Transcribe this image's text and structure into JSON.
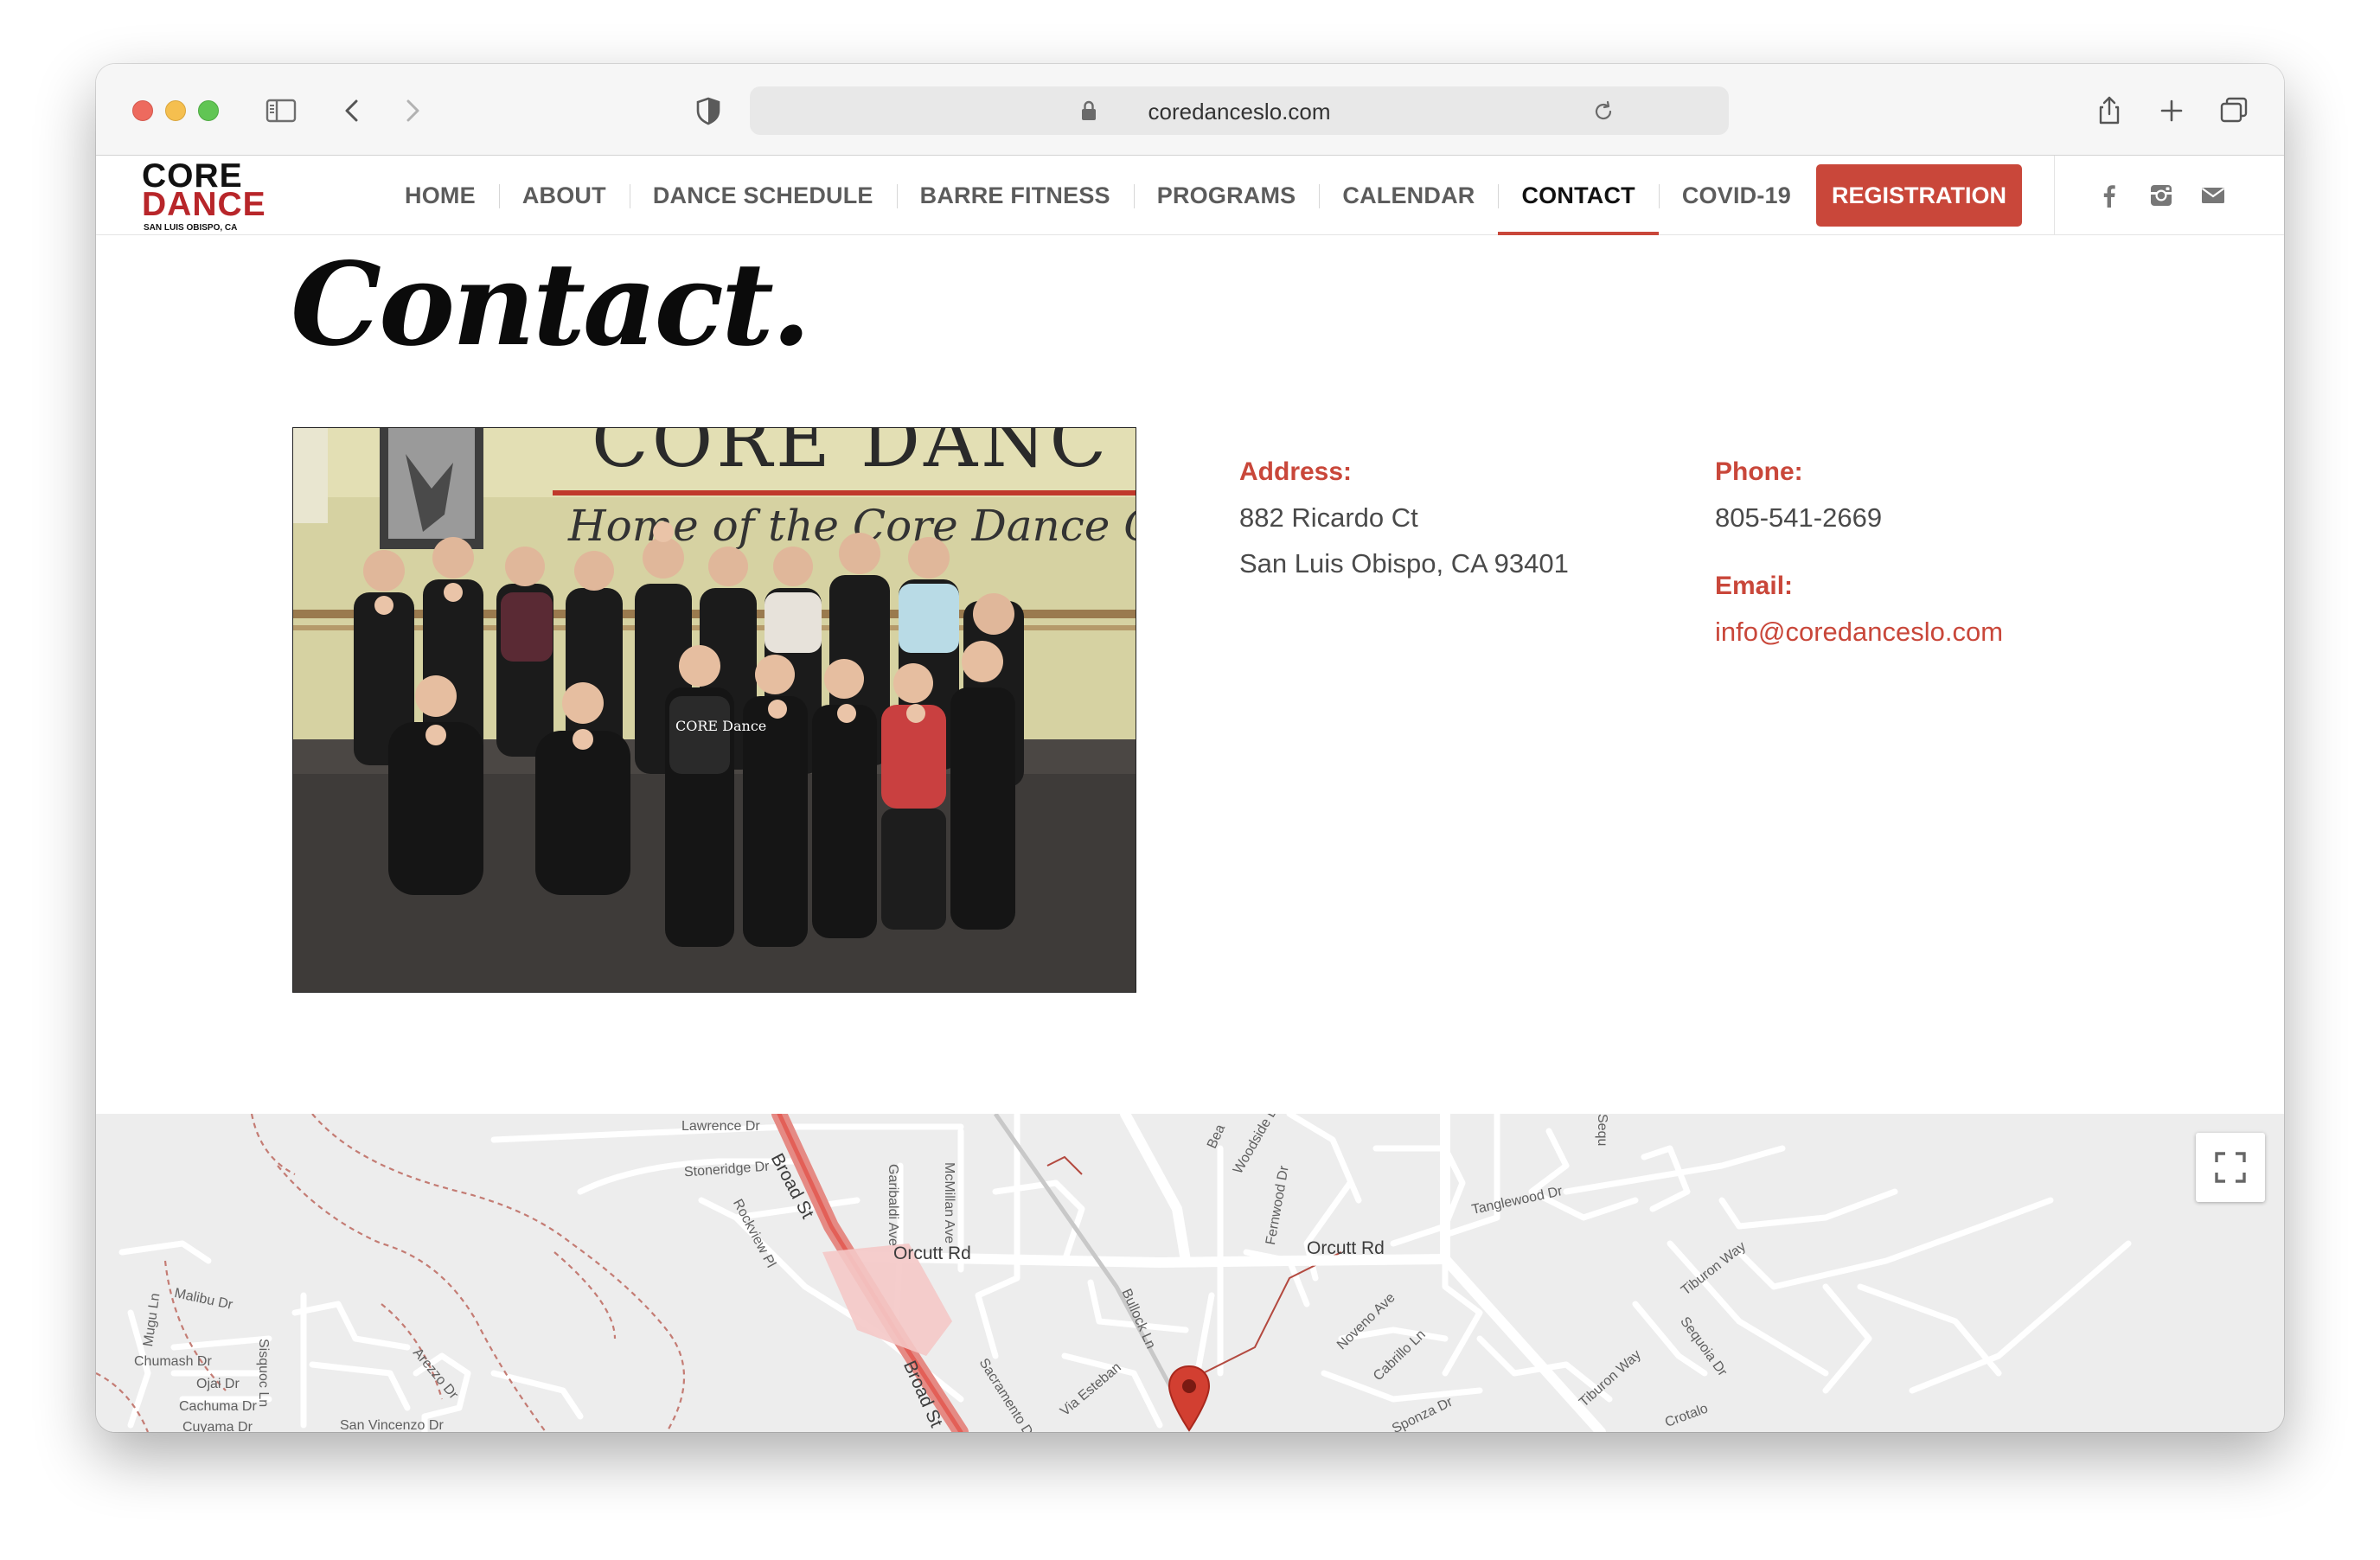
{
  "browser": {
    "url": "coredanceslo.com"
  },
  "site": {
    "logo": {
      "line1": "CORE",
      "line2": "DANCE",
      "tagline": "SAN LUIS OBISPO, CA"
    },
    "nav": [
      {
        "label": "HOME"
      },
      {
        "label": "ABOUT"
      },
      {
        "label": "DANCE SCHEDULE"
      },
      {
        "label": "BARRE FITNESS"
      },
      {
        "label": "PROGRAMS"
      },
      {
        "label": "CALENDAR"
      },
      {
        "label": "CONTACT",
        "active": true
      },
      {
        "label": "COVID-19"
      }
    ],
    "registration_label": "REGISTRATION",
    "social": [
      "facebook-icon",
      "instagram-icon",
      "mail-icon"
    ]
  },
  "page": {
    "title": "Contact.",
    "photo_sign": {
      "line1": "CORE DANC",
      "line2": "Home of the Core Dance Com"
    },
    "photo_shirt": "CORE Dance",
    "address": {
      "label": "Address:",
      "line1": "882 Ricardo Ct",
      "line2": "San Luis Obispo, CA 93401"
    },
    "phone": {
      "label": "Phone:",
      "value": "805-541-2669"
    },
    "email": {
      "label": "Email:",
      "value": "info@coredanceslo.com"
    }
  },
  "map": {
    "streets": [
      "Lawrence Dr",
      "Broad St",
      "Stoneridge Dr",
      "Rockview Pl",
      "Garibaldi Ave",
      "McMillan Ave",
      "Orcutt Rd",
      "Orcutt Rd",
      "Woodside Dr",
      "Fernwood Dr",
      "Tanglewood Dr",
      "Tiburon Way",
      "Malibu Dr",
      "Mugu Ln",
      "Chumash Dr",
      "Ojai Dr",
      "Cachuma Dr",
      "Cuyama Dr",
      "Sisquoc Ln",
      "Arezzo Dr",
      "San Vincenzo Dr",
      "Sacramento Dr",
      "Via Esteban",
      "Bullock Ln",
      "Noveno Ave",
      "Cabrillo Ln",
      "Sponza Dr",
      "Tiburon Way",
      "Sequoia Dr",
      "Crotalo",
      "Broad St",
      "Bea",
      "Sequ"
    ],
    "pin_color": "#d23f31"
  },
  "colors": {
    "accent": "#c9473a",
    "logo_red": "#b8262a"
  }
}
